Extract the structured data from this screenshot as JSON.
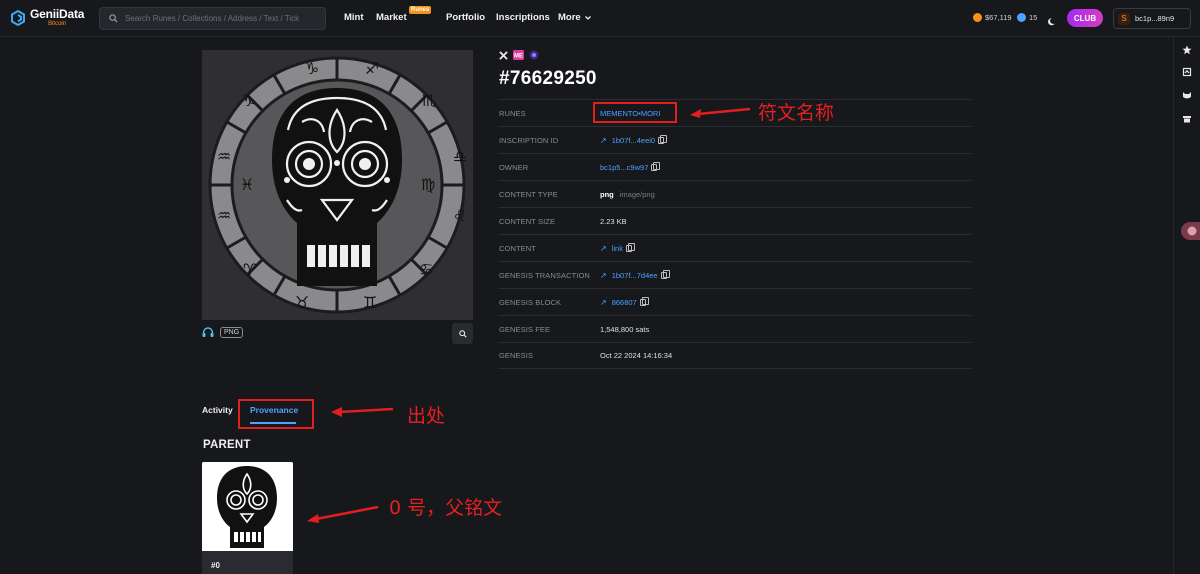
{
  "header": {
    "logo_name": "GeniiData",
    "logo_sub": "Bitcoin",
    "search_placeholder": "Search Runes / Collections / Address / Text / Tick",
    "nav": {
      "mint": "Mint",
      "market": "Market",
      "market_badge": "Runes",
      "portfolio": "Portfolio",
      "inscriptions": "Inscriptions",
      "more": "More"
    },
    "btc_price": "$67,119",
    "fee_rate": "15",
    "club_label": "CLUB",
    "wallet_address": "bc1p...89n9"
  },
  "inscription": {
    "title": "#76629250",
    "png_badge": "PNG",
    "details": [
      {
        "label": "RUNES",
        "value": "MEMENTO•MORI",
        "kind": "link"
      },
      {
        "label": "INSCRIPTION ID",
        "value": "1b07f...4eei0",
        "kind": "arrow-link-copy"
      },
      {
        "label": "OWNER",
        "value": "bc1p5...c9w97",
        "kind": "link-copy"
      },
      {
        "label": "CONTENT TYPE",
        "value": "png",
        "extra": "image/png",
        "kind": "type"
      },
      {
        "label": "CONTENT SIZE",
        "value": "2.23 KB",
        "kind": "text"
      },
      {
        "label": "CONTENT",
        "value": "link",
        "kind": "arrow-link-copy"
      },
      {
        "label": "GENESIS TRANSACTION",
        "value": "1b07f...7d4ee",
        "kind": "arrow-link-copy"
      },
      {
        "label": "GENESIS BLOCK",
        "value": "866807",
        "kind": "arrow-link-copy"
      },
      {
        "label": "GENESIS FEE",
        "value": "1,548,800 sats",
        "kind": "text"
      },
      {
        "label": "GENESIS",
        "value": "Oct 22 2024 14:16:34",
        "kind": "text"
      }
    ]
  },
  "tabs": {
    "activity": "Activity",
    "provenance": "Provenance"
  },
  "parent": {
    "heading": "PARENT",
    "item_label": "#0"
  },
  "annotations": {
    "runes_note": "符文名称",
    "provenance_note": "出处",
    "parent_note": "0 号，父铭文"
  },
  "colors": {
    "accent_blue": "#4aa3ff",
    "annotation_red": "#e11f1f",
    "bitcoin_orange": "#f7931a",
    "club_purple": "#c035dc"
  }
}
